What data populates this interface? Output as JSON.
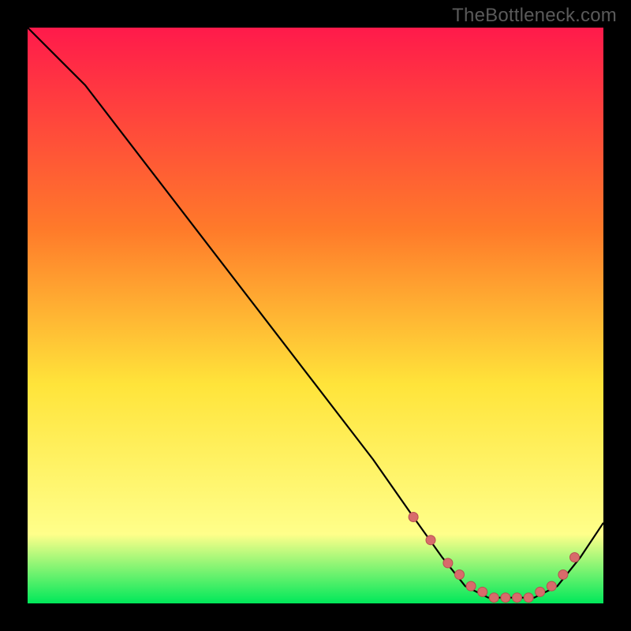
{
  "watermark": "TheBottleneck.com",
  "colors": {
    "bg": "#000000",
    "grad_top": "#ff1a4b",
    "grad_mid1": "#ff7a2a",
    "grad_mid2": "#ffe43a",
    "grad_low": "#ffff8a",
    "grad_bottom": "#00e85a",
    "line": "#000000",
    "marker_fill": "#d86b6b",
    "marker_stroke": "#b85050"
  },
  "chart_data": {
    "type": "line",
    "title": "",
    "xlabel": "",
    "ylabel": "",
    "xlim": [
      0,
      100
    ],
    "ylim": [
      0,
      100
    ],
    "series": [
      {
        "name": "curve",
        "x": [
          0,
          6,
          10,
          20,
          30,
          40,
          50,
          60,
          67,
          72,
          76,
          80,
          84,
          88,
          92,
          96,
          100
        ],
        "y": [
          100,
          94,
          90,
          77,
          64,
          51,
          38,
          25,
          15,
          8,
          3,
          1,
          1,
          1,
          3,
          8,
          14
        ]
      }
    ],
    "markers": {
      "name": "highlight-points",
      "x": [
        67,
        70,
        73,
        75,
        77,
        79,
        81,
        83,
        85,
        87,
        89,
        91,
        93,
        95
      ],
      "y": [
        15,
        11,
        7,
        5,
        3,
        2,
        1,
        1,
        1,
        1,
        2,
        3,
        5,
        8
      ]
    }
  }
}
